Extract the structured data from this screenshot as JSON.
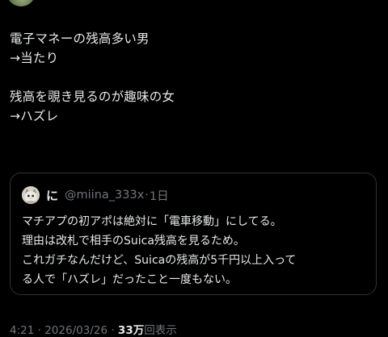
{
  "post": {
    "lines": [
      "電子マネーの残高多い男",
      "→当たり",
      "",
      "残高を覗き見るのが趣味の女",
      "→ハズレ"
    ]
  },
  "quote": {
    "display_name": "に",
    "handle": "@miina_333x",
    "separator": "·",
    "time": "1日",
    "lines": [
      "マチアプの初アポは絶対に「電車移動」にしてる。",
      "理由は改札で相手のSuica残高を見るため。",
      "これガチなんだけど、Suicaの残高が5千円以上入って",
      "る人で「ハズレ」だったこと一度もない。"
    ]
  },
  "meta": {
    "time": "4:21",
    "separator1": "·",
    "date": "2026/03/26",
    "separator2": "·",
    "views_count": "33万",
    "views_label": "回表示"
  },
  "colors": {
    "background": "#000000",
    "text_primary": "#e7e9ea",
    "text_secondary": "#71767b",
    "border": "#2f3336"
  }
}
